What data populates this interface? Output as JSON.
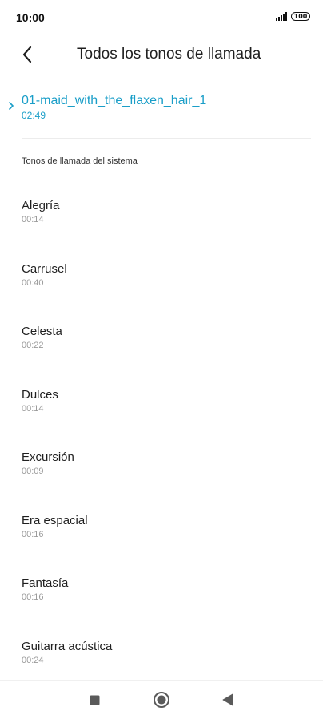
{
  "status_bar": {
    "time": "10:00",
    "battery": "100",
    "signal_icon": "signal-bars-icon"
  },
  "header": {
    "back_icon": "chevron-left-icon",
    "title": "Todos los tonos de llamada"
  },
  "current": {
    "indicator_icon": "chevron-right-icon",
    "name": "01-maid_with_the_flaxen_hair_1",
    "duration": "02:49"
  },
  "section": {
    "title": "Tonos de llamada del sistema"
  },
  "ringtones": [
    {
      "name": "Alegría",
      "duration": "00:14"
    },
    {
      "name": "Carrusel",
      "duration": "00:40"
    },
    {
      "name": "Celesta",
      "duration": "00:22"
    },
    {
      "name": "Dulces",
      "duration": "00:14"
    },
    {
      "name": "Excursión",
      "duration": "00:09"
    },
    {
      "name": "Era espacial",
      "duration": "00:16"
    },
    {
      "name": "Fantasía",
      "duration": "00:16"
    },
    {
      "name": "Guitarra acústica",
      "duration": "00:24"
    }
  ],
  "nav": {
    "recents_icon": "square-icon",
    "home_icon": "circle-icon",
    "back_icon": "triangle-back-icon"
  },
  "colors": {
    "accent": "#1a9ec8",
    "text_primary": "#1f1f1f",
    "text_secondary": "#9a9a9a"
  }
}
